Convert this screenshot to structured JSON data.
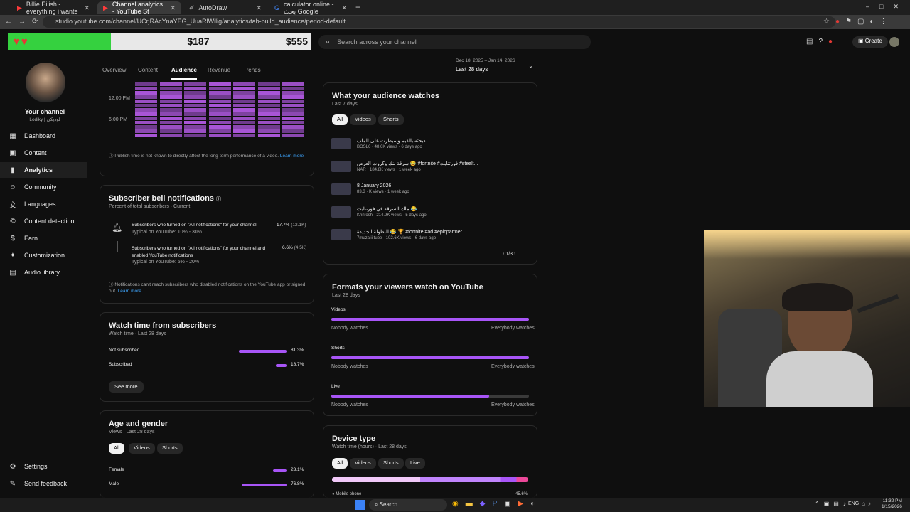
{
  "browser": {
    "tabs": [
      {
        "label": "Billie Eilish - everything i wante"
      },
      {
        "label": "Channel analytics - YouTube St"
      },
      {
        "label": "AutoDraw"
      },
      {
        "label": "calculator online - بحث Google"
      }
    ],
    "url": "studio.youtube.com/channel/UCrjRAcYnaYEG_UuaRlWilig/analytics/tab-build_audience/period-default"
  },
  "counter": {
    "left": "$187",
    "right": "$555"
  },
  "search": {
    "placeholder": "Search across your channel"
  },
  "header": {
    "create": "Create"
  },
  "channel": {
    "title": "Your channel",
    "handle": "Lodiky | لوديكي"
  },
  "nav": [
    {
      "label": "Dashboard",
      "icon": "dashboard-icon"
    },
    {
      "label": "Content",
      "icon": "content-icon"
    },
    {
      "label": "Analytics",
      "icon": "analytics-icon"
    },
    {
      "label": "Community",
      "icon": "community-icon"
    },
    {
      "label": "Languages",
      "icon": "languages-icon"
    },
    {
      "label": "Content detection",
      "icon": "copyright-icon"
    },
    {
      "label": "Earn",
      "icon": "dollar-icon"
    },
    {
      "label": "Customization",
      "icon": "wand-icon"
    },
    {
      "label": "Audio library",
      "icon": "audio-icon"
    }
  ],
  "nav_bottom": [
    {
      "label": "Settings"
    },
    {
      "label": "Send feedback"
    }
  ],
  "tabs": [
    "Overview",
    "Content",
    "Audience",
    "Revenue",
    "Trends"
  ],
  "date_range": {
    "range": "Dec 18, 2025 – Jan 14, 2026",
    "label": "Last 28 days"
  },
  "heatmap": {
    "y_labels": [
      "12:00 PM",
      "6:00 PM"
    ],
    "note": "Publish time is not known to directly affect the long-term performance of a video.",
    "learn": "Learn more"
  },
  "bell": {
    "title": "Subscriber bell notifications",
    "sub": "Percent of total subscribers · Current",
    "row1": {
      "label": "Subscribers who turned on \"All notifications\" for your channel",
      "typical": "Typical on YouTube: 10% - 30%",
      "value": "17.7%",
      "count": "(12.1K)"
    },
    "row2": {
      "label": "Subscribers who turned on \"All notifications\" for your channel and enabled YouTube notifications",
      "typical": "Typical on YouTube: 5% - 20%",
      "value": "6.6%",
      "count": "(4.5K)"
    },
    "note": "Notifications can't reach subscribers who disabled notifications on the YouTube app or signed out.",
    "learn": "Learn more"
  },
  "watchtime": {
    "title": "Watch time from subscribers",
    "sub": "Watch time · Last 28 days",
    "rows": [
      {
        "label": "Not subscribed",
        "value": "81.3%",
        "fraction": 0.813
      },
      {
        "label": "Subscribed",
        "value": "18.7%",
        "fraction": 0.187
      }
    ],
    "see_more": "See more"
  },
  "age": {
    "title": "Age and gender",
    "sub": "Views · Last 28 days",
    "pills": [
      "All",
      "Videos",
      "Shorts"
    ],
    "rows": [
      {
        "label": "Female",
        "value": "23.1%",
        "fraction": 0.231
      },
      {
        "label": "Male",
        "value": "76.8%",
        "fraction": 0.768
      }
    ]
  },
  "watches": {
    "title": "What your audience watches",
    "sub": "Last 7 days",
    "pills": [
      "All",
      "Videos",
      "Shorts"
    ],
    "videos": [
      {
        "title": "ذبحته بالقيم وسيطرت على الماب",
        "meta": "BOSL6 · 48.6K views · 6 days ago"
      },
      {
        "title": "سرقة بنك وكروت العرض 😂 #fortnite #فورتنايت #stealt...",
        "meta": "NAR · 184.8K views · 1 week ago"
      },
      {
        "title": "8 January 2026",
        "meta": "83.3 · K views · 1 week ago"
      },
      {
        "title": "ملك السرقة في فورتنايت 😂",
        "meta": "Khnfosh · 214.9K views · 5 days ago"
      },
      {
        "title": "البطولة الجديدة 😂 🏆 #fortnite #ad #epicpartner",
        "meta": "7muzaiii tube · 102.6K views · 6 days ago"
      }
    ],
    "pager": "1/3"
  },
  "formats": {
    "title": "Formats your viewers watch on YouTube",
    "sub": "Last 28 days",
    "rows": [
      {
        "label": "Videos",
        "fill": 1.0
      },
      {
        "label": "Shorts",
        "fill": 1.0
      },
      {
        "label": "Live",
        "fill": 0.8
      }
    ],
    "min_label": "Nobody watches",
    "max_label": "Everybody watches"
  },
  "device": {
    "title": "Device type",
    "sub": "Watch time (hours) · Last 28 days",
    "pills": [
      "All",
      "Videos",
      "Shorts",
      "Live"
    ],
    "first": {
      "label": "Mobile phone",
      "value": "45.6%"
    }
  },
  "taskbar": {
    "search": "Search",
    "lang": "ENG",
    "time": "11:32 PM",
    "date": "1/15/2026"
  },
  "colors": {
    "accent": "#a855f7",
    "counter_green": "#35d13f"
  }
}
